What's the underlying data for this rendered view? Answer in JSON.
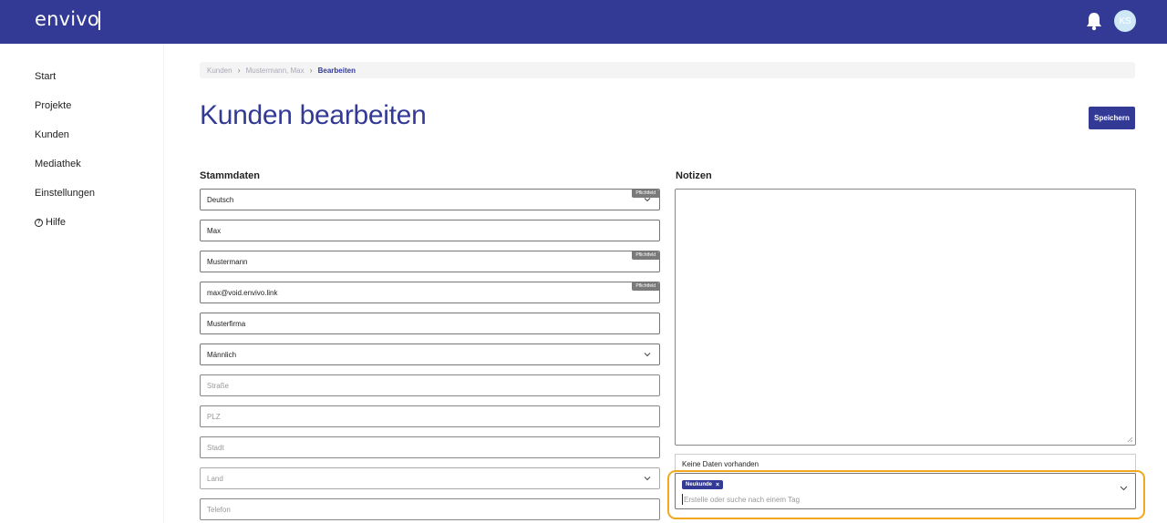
{
  "header": {
    "logo": "envivo",
    "avatar_initials": "KS"
  },
  "sidebar": {
    "items": [
      {
        "label": "Start"
      },
      {
        "label": "Projekte"
      },
      {
        "label": "Kunden"
      },
      {
        "label": "Mediathek"
      },
      {
        "label": "Einstellungen"
      },
      {
        "label": "Hilfe"
      }
    ]
  },
  "breadcrumb": [
    "Kunden",
    "Mustermann, Max",
    "Bearbeiten"
  ],
  "page": {
    "title": "Kunden bearbeiten",
    "save_label": "Speichern"
  },
  "stammdaten": {
    "title": "Stammdaten",
    "required_badge": "Pflichtfeld",
    "fields": [
      {
        "value": "Deutsch",
        "type": "select",
        "required": true
      },
      {
        "value": "Max",
        "type": "text"
      },
      {
        "value": "Mustermann",
        "type": "text",
        "required": true
      },
      {
        "value": "max@void.envivo.link",
        "type": "text",
        "required": true
      },
      {
        "value": "Musterfirma",
        "type": "text"
      },
      {
        "value": "Männlich",
        "type": "select"
      },
      {
        "placeholder": "Straße",
        "type": "text"
      },
      {
        "placeholder": "PLZ",
        "type": "text"
      },
      {
        "placeholder": "Stadt",
        "type": "text"
      },
      {
        "placeholder": "Land",
        "type": "select"
      },
      {
        "placeholder": "Telefon",
        "type": "text"
      }
    ]
  },
  "notizen": {
    "title": "Notizen",
    "value": ""
  },
  "tags": {
    "dropdown_message": "Keine Daten vorhanden",
    "selected": [
      "Neukunde"
    ],
    "remove_symbol": "×",
    "placeholder": "Erstelle oder suche nach einem Tag"
  },
  "colors": {
    "brand": "#323a96",
    "highlight": "#f2a81d"
  }
}
